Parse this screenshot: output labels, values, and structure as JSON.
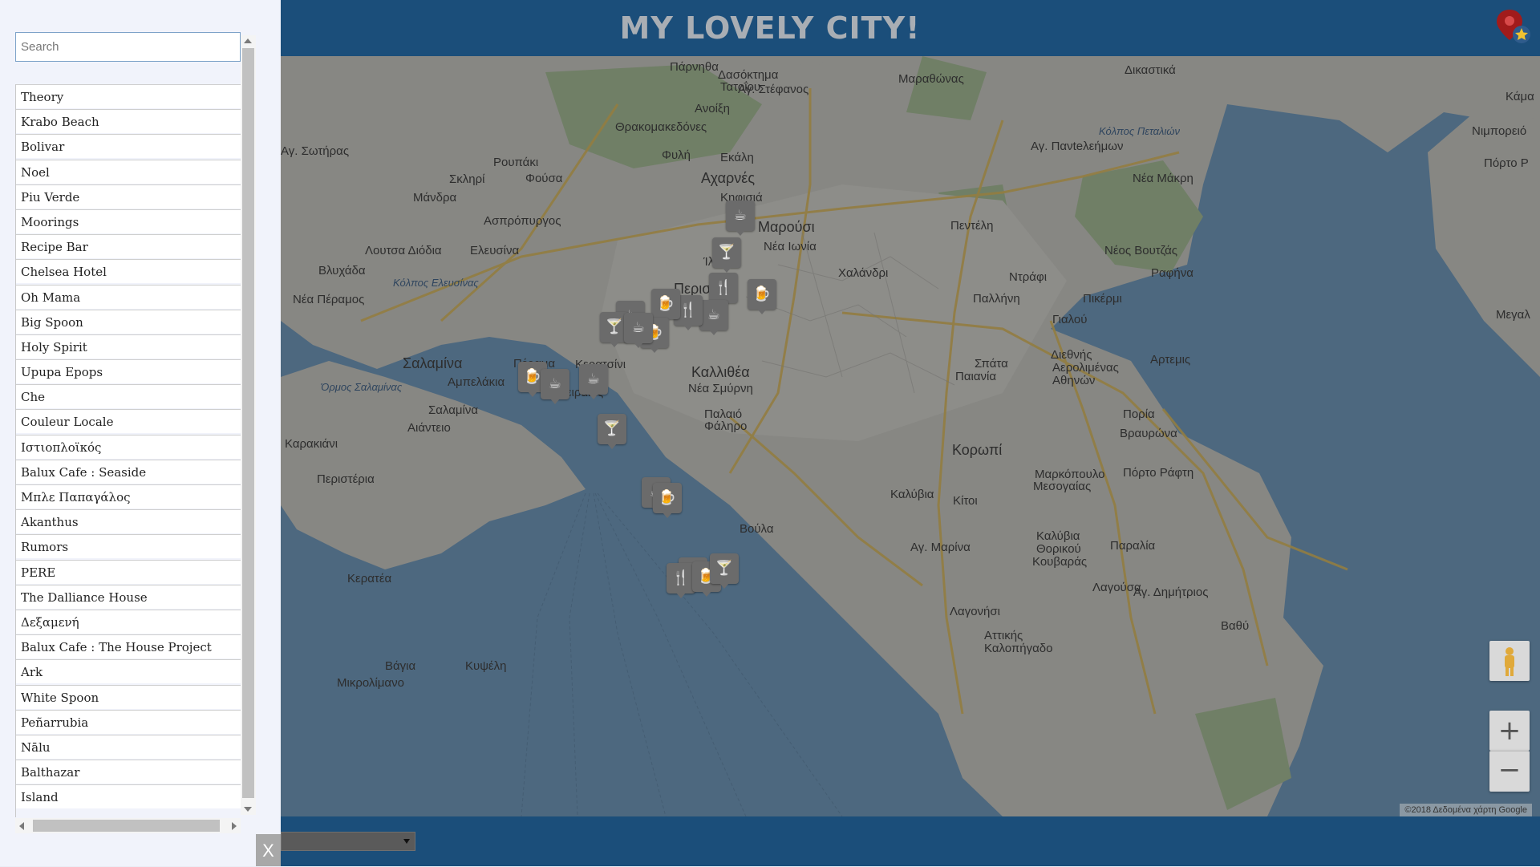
{
  "header": {
    "title": "MY LOVELY CITY!",
    "logo_icon": "map-pin-star-icon"
  },
  "sidebar": {
    "search_placeholder": "Search",
    "search_value": "",
    "places": [
      "Theory",
      "Krabo Beach",
      "Bolivar",
      "Noel",
      "Piu Verde",
      "Moorings",
      "Recipe Bar",
      "Chelsea Hotel",
      "Oh Mama",
      "Big Spoon",
      "Holy Spirit",
      "Upupa Epops",
      "Che",
      "Couleur Locale",
      "Ιστιοπλοϊκός",
      "Balux Cafe : Seaside",
      "Μπλε Παπαγάλος",
      "Akanthus",
      "Rumors",
      "PERE",
      "The Dalliance House",
      "Δεξαμενή",
      "Balux Cafe : The House Project",
      "Ark",
      "White Spoon",
      "Peñarrubia",
      "Nālu",
      "Balthazar",
      "Island"
    ],
    "close_label": "X"
  },
  "map": {
    "labels": [
      {
        "text": "Πάρνηθα"
      },
      {
        "text": "Δασόκτημα"
      },
      {
        "text": "Τατοΐου"
      },
      {
        "text": "Μαραθώνας"
      },
      {
        "text": "Δικαστικά"
      },
      {
        "text": "Κάμα"
      },
      {
        "text": "Αγ. Στέφανος"
      },
      {
        "text": "Ανοίξη"
      },
      {
        "text": "Θρακομακεδόνες"
      },
      {
        "text": "Αγ. Πανteλεήμων"
      },
      {
        "text": "Κόλπος Πεταλιών"
      },
      {
        "text": "Νιμπορειό"
      },
      {
        "text": "Αγ. Σωτήρας"
      },
      {
        "text": "Φυλή"
      },
      {
        "text": "Εκάλη"
      },
      {
        "text": "Πόρτο Ρ"
      },
      {
        "text": "Ρουπάκι"
      },
      {
        "text": "Σκληρί"
      },
      {
        "text": "Φούσα"
      },
      {
        "text": "Αχαρνές"
      },
      {
        "text": "Νέα Μάκρη"
      },
      {
        "text": "Μάνδρα"
      },
      {
        "text": "Κηφισιά"
      },
      {
        "text": "Ασπρόπυργος"
      },
      {
        "text": "Μαρούσι"
      },
      {
        "text": "Πεντέλη"
      },
      {
        "text": "Λουτσα Διόδια"
      },
      {
        "text": "Ελευσίνα"
      },
      {
        "text": "Νέα Ιωνία"
      },
      {
        "text": "Νέος Βουτζάς"
      },
      {
        "text": "Βλυχάδα"
      },
      {
        "text": "Ίλιον"
      },
      {
        "text": "Χαλάνδρι"
      },
      {
        "text": "Ντράφι"
      },
      {
        "text": "Ραφήνα"
      },
      {
        "text": "Κόλπος Ελευσίνας"
      },
      {
        "text": "Νέα Πέραμος"
      },
      {
        "text": "Περιστέρι"
      },
      {
        "text": "Παλλήνη"
      },
      {
        "text": "Πικέρμι"
      },
      {
        "text": "Μεγαλ"
      },
      {
        "text": "Γιαλού"
      },
      {
        "text": "Σαλαμίνα"
      },
      {
        "text": "Πέραμα"
      },
      {
        "text": "Κερατσίνι"
      },
      {
        "text": "Σπάτα"
      },
      {
        "text": "Διεθνής"
      },
      {
        "text": "Αερολιμένας"
      },
      {
        "text": "Αθηνών"
      },
      {
        "text": "Αρτεμις"
      },
      {
        "text": "Αμπελάκια"
      },
      {
        "text": "Καλλιθέα"
      },
      {
        "text": "Παιανία"
      },
      {
        "text": "Όρμος Σαλαμίνας"
      },
      {
        "text": "Νέα Σμύρνη"
      },
      {
        "text": "Πειραιάς"
      },
      {
        "text": "Σαλαμίνα"
      },
      {
        "text": "Παλαιό"
      },
      {
        "text": "Φάληρο"
      },
      {
        "text": "Πορία"
      },
      {
        "text": "Βραυρώνα"
      },
      {
        "text": "Αιάντειο"
      },
      {
        "text": "Καρακιάνι"
      },
      {
        "text": "Κορωπί"
      },
      {
        "text": "Πόρτο Ράφτη"
      },
      {
        "text": "Περιστέρια"
      },
      {
        "text": "Μαρκόπουλο"
      },
      {
        "text": "Μεσογαίας"
      },
      {
        "text": "Καλύβια"
      },
      {
        "text": "Κίτοι"
      },
      {
        "text": "Βούλα"
      },
      {
        "text": "Καλύβια"
      },
      {
        "text": "Θορικού"
      },
      {
        "text": "Παραλία"
      },
      {
        "text": "Αγ. Μαρίνα"
      },
      {
        "text": "Κουβαράς"
      },
      {
        "text": "Λαγούσα"
      },
      {
        "text": "Κερατέα"
      },
      {
        "text": "Αγ. Δημήτριος"
      },
      {
        "text": "Λαγονήσι"
      },
      {
        "text": "Αττικής"
      },
      {
        "text": "Καλοπήγαδο"
      },
      {
        "text": "Βαθύ"
      },
      {
        "text": "Βάγια"
      },
      {
        "text": "Κυψέλη"
      },
      {
        "text": "Μικρολίμανο"
      }
    ],
    "markers": [
      {
        "name": "bar-marker-icon",
        "glyph": "🍸"
      },
      {
        "name": "cafe-marker-icon",
        "glyph": "☕"
      },
      {
        "name": "restaurant-marker-icon",
        "glyph": "🍴"
      },
      {
        "name": "pub-marker-icon",
        "glyph": "🍺"
      }
    ],
    "attribution": "©2018 Δεδομένα χάρτη Google",
    "controls": {
      "pegman_icon": "pegman-icon",
      "zoom_in_label": "+",
      "zoom_out_label": "−"
    }
  },
  "footer": {
    "filter_selected": ""
  },
  "colors": {
    "header_bg": "#1b4e7a",
    "sidebar_bg": "#f1f3fb",
    "title_color": "#a9aeb4",
    "marker_bg": "#6b6b6b",
    "water": "#587d9d"
  }
}
